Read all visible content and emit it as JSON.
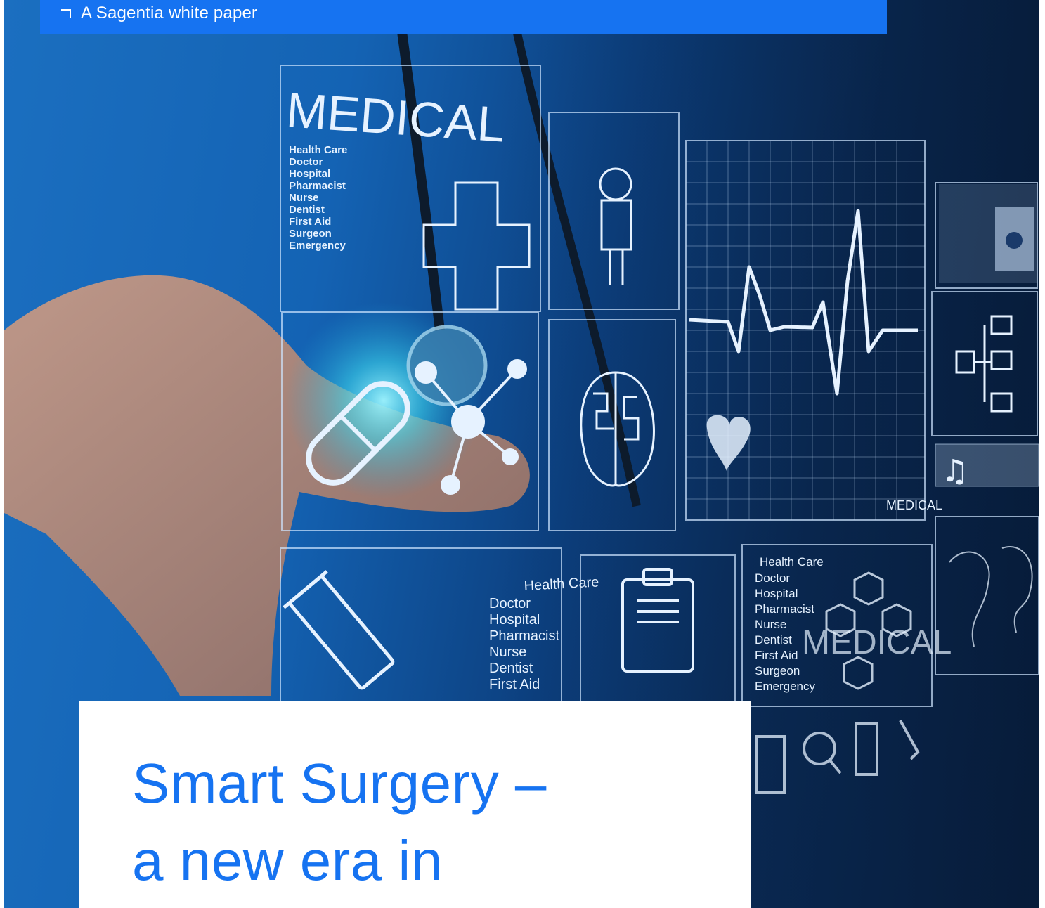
{
  "banner": {
    "icon": "corner-bracket-icon",
    "text": "A Sagentia white paper"
  },
  "cover_photo": {
    "description_icon": "medical-hologram-photo",
    "overlay_texts": {
      "panel_title_large": "MEDICAL",
      "panel_list_left": [
        "Health Care",
        "Doctor",
        "Hospital",
        "Pharmacist",
        "Nurse",
        "Dentist",
        "First Aid",
        "Surgeon",
        "Emergency"
      ],
      "panel_list_bottom_center": [
        "Health Care",
        "Doctor",
        "Hospital",
        "Pharmacist",
        "Nurse",
        "Dentist",
        "First Aid"
      ],
      "panel_list_bottom_right": [
        "Health Care",
        "Doctor",
        "Hospital",
        "Pharmacist",
        "Nurse",
        "Dentist",
        "First Aid",
        "Surgeon",
        "Emergency"
      ],
      "ecg_label": "MEDICAL",
      "bottom_right_watermark": "MEDICAL"
    }
  },
  "title": {
    "line1": "Smart Surgery –",
    "line2": "a new era in"
  },
  "colors": {
    "brand_blue": "#1673f1",
    "photo_dark": "#0a2a55"
  }
}
